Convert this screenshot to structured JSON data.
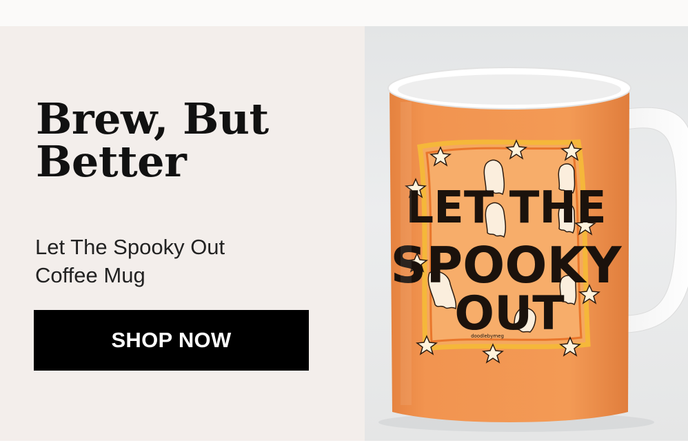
{
  "banner": {
    "headline_line1": "Brew, But",
    "headline_line2": "Better",
    "subtitle_line1": "Let The Spooky Out",
    "subtitle_line2": "Coffee Mug",
    "cta_label": "SHOP NOW"
  },
  "product": {
    "print_line1": "LET THE",
    "print_line2": "SPOOKY",
    "print_line3": "OUT",
    "signature": "doodlebymeg"
  },
  "colors": {
    "left_bg": "#f3eeeb",
    "cta_bg": "#000000",
    "mug_orange": "#f2924c",
    "print_frame": "#f5b73a"
  }
}
